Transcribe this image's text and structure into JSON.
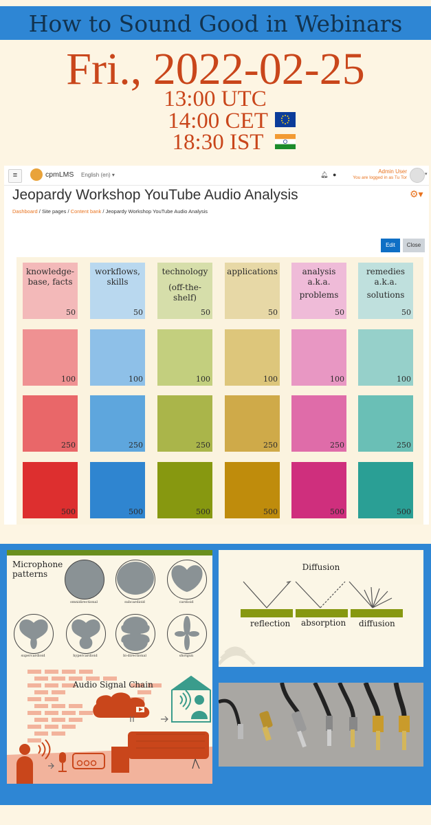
{
  "banner": {
    "title": "How to Sound Good in Webinars"
  },
  "event": {
    "date": "Fri., 2022-02-25",
    "times": [
      "13:00 UTC",
      "14:00 CET",
      "18:30 IST"
    ]
  },
  "moodle": {
    "site_name": "cpmLMS",
    "language": "English (en) ▾",
    "user_name": "Admin User",
    "login_note": "You are logged in as Tu Tor",
    "page_title": "Jeopardy Workshop YouTube Audio Analysis",
    "breadcrumb": [
      "Dashboard",
      "Site pages",
      "Content bank",
      "Jeopardy Workshop YouTube Audio Analysis"
    ],
    "edit_label": "Edit",
    "close_label": "Close"
  },
  "board": {
    "categories": [
      {
        "line1": "knowledge-",
        "line2": "base, facts",
        "sub": "",
        "colors": [
          "#f3b9b9",
          "#ef9192",
          "#e96769",
          "#dd2f2f"
        ]
      },
      {
        "line1": "workflows,",
        "line2": "skills",
        "sub": "",
        "colors": [
          "#b9d8ef",
          "#8ec0e8",
          "#5ea6dd",
          "#2f85d0"
        ]
      },
      {
        "line1": "technology",
        "line2": "",
        "sub": "(off-the-shelf)",
        "colors": [
          "#d6deaa",
          "#c3cf7e",
          "#aab54a",
          "#879810"
        ]
      },
      {
        "line1": "applications",
        "line2": "",
        "sub": "",
        "colors": [
          "#e7d8a6",
          "#ddc67b",
          "#cfaa49",
          "#bf8c0c"
        ]
      },
      {
        "line1": "analysis",
        "line2": "a.k.a.",
        "sub": "problems",
        "colors": [
          "#efbbd8",
          "#e897c3",
          "#df6ca9",
          "#cf2f7d"
        ]
      },
      {
        "line1": "remedies",
        "line2": "a.k.a.",
        "sub": "solutions",
        "colors": [
          "#bfe0dd",
          "#96d0ca",
          "#6abfb6",
          "#2a9f95"
        ]
      }
    ],
    "points": [
      "50",
      "100",
      "250",
      "500"
    ]
  },
  "mic_patterns": {
    "title_line1": "Microphone",
    "title_line2": "patterns",
    "labels": [
      "omnidirectional",
      "subcardioid",
      "cardioid",
      "supercardioid",
      "hypercardioid",
      "bi-directional",
      "shotgun"
    ]
  },
  "signal_chain": {
    "title": "Audio Signal Chain"
  },
  "diffusion": {
    "title": "Diffusion",
    "labels": [
      "reflection",
      "absorption",
      "diffusion"
    ]
  },
  "colors": {
    "banner": "#2e86d4",
    "accent_orange": "#c9461b",
    "moodle_orange": "#e8731f",
    "moodle_blue": "#0f6fc5",
    "olive": "#879810"
  }
}
